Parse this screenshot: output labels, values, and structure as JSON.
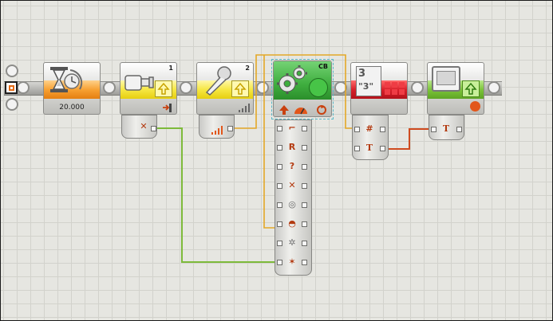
{
  "program": {
    "start_label": "",
    "blocks": [
      {
        "id": "wait",
        "value": "20.000",
        "number": "",
        "accent": "#f7a133"
      },
      {
        "id": "touch-sensor",
        "value": "",
        "number": "1",
        "accent": "#f6e743"
      },
      {
        "id": "sound-sensor",
        "value": "",
        "number": "2",
        "accent": "#f6e743"
      },
      {
        "id": "move",
        "value": "",
        "number": "CB",
        "accent": "#3fae3f"
      },
      {
        "id": "number-to-text",
        "value": "",
        "number": "",
        "accent": "#d8202a"
      },
      {
        "id": "display",
        "value": "",
        "number": "",
        "accent": "#7cc43a"
      }
    ],
    "number_to_text": {
      "top": "3",
      "bottom": "\"3\""
    },
    "data_hub": {
      "touch_plug_icon": "tool-icon",
      "move_plugs": [
        "left-motor-icon",
        "right-motor-icon",
        "third-motor-icon",
        "direction-icon",
        "steering-icon",
        "power-icon",
        "duration-icon",
        "action-icon"
      ]
    },
    "wire_colors": {
      "number": "#e4a827",
      "logic": "#7dba3a",
      "text": "#cf4b1f"
    },
    "number_text_plug": "#",
    "text_plug": "T"
  }
}
